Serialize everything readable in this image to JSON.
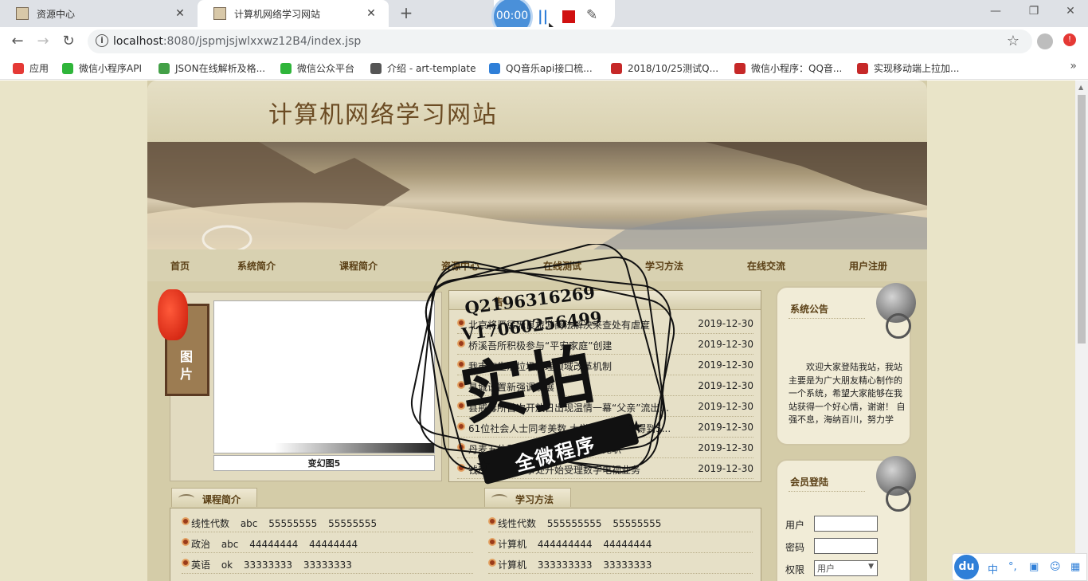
{
  "browser": {
    "tabs": [
      {
        "title": "资源中心",
        "active": false
      },
      {
        "title": "计算机网络学习网站",
        "active": true
      }
    ],
    "url_host": "localhost",
    "url_path": ":8080/jspmjsjwlxxwz12B4/index.jsp",
    "bookmarks": [
      {
        "label": "应用",
        "icon_color": "#e53935"
      },
      {
        "label": "微信小程序API",
        "icon_color": "#2fb53a"
      },
      {
        "label": "JSON在线解析及格...",
        "icon_color": "#43a047"
      },
      {
        "label": "微信公众平台",
        "icon_color": "#2fb53a"
      },
      {
        "label": "介绍 - art-template",
        "icon_color": "#555555"
      },
      {
        "label": "QQ音乐api接口梳...",
        "icon_color": "#2f7fd8"
      },
      {
        "label": "2018/10/25测试Q...",
        "icon_color": "#c62828"
      },
      {
        "label": "微信小程序：QQ音...",
        "icon_color": "#c62828"
      },
      {
        "label": "实现移动端上拉加...",
        "icon_color": "#c62828"
      }
    ],
    "more": "»"
  },
  "recorder": {
    "time": "00:00",
    "pause": "||"
  },
  "site": {
    "title": "计算机网络学习网站",
    "nav": [
      "首页",
      "系统简介",
      "课程简介",
      "资源中心",
      "在线测试",
      "学习方法",
      "在线交流",
      "用户注册"
    ],
    "image_tab": [
      "图",
      "片"
    ],
    "slide_caption": "变幻图5",
    "news_title": "告",
    "news": [
      {
        "title": "北京将严惩无良旅游商法解决来查处有虐度",
        "date": "2019-12-30"
      },
      {
        "title": "桥溪吾所积极参与“平安家庭”创建",
        "date": "2019-12-30"
      },
      {
        "title": "我市市生活垃圾处理领域改革机制",
        "date": "2019-12-30"
      },
      {
        "title": "县城设置新强调发展",
        "date": "2019-12-30"
      },
      {
        "title": "县戒毒所首次开放日出现温情一幕“父亲”流出...",
        "date": "2019-12-30"
      },
      {
        "title": "61位社会人士同考美数 大学数学教师只得到5...",
        "date": "2019-12-30"
      },
      {
        "title": "丹麦五位贸易促进大使被新政府免职",
        "date": "2019-12-30"
      },
      {
        "title": "钱库镇新安办事处开始受理数字电视业务",
        "date": "2019-12-30"
      }
    ],
    "notice": {
      "title": "系统公告",
      "text": "欢迎大家登陆我站，我站主要是为广大朋友精心制作的一个系统，希望大家能够在我站获得一个好心情，谢谢！ 自强不息，海纳百川，努力学"
    },
    "login": {
      "title": "会员登陆",
      "user_label": "用户",
      "pass_label": "密码",
      "role_label": "权限",
      "role_value": "用户"
    },
    "course_section": {
      "title": "课程简介",
      "rows": [
        "线性代数 abc 55555555 55555555",
        "政治 abc 44444444 44444444",
        "英语 ok 33333333 33333333"
      ]
    },
    "method_section": {
      "title": "学习方法",
      "rows": [
        "线性代数 555555555 55555555",
        "计算机 444444444 44444444",
        "计算机 333333333 33333333"
      ]
    }
  },
  "stamp": {
    "line1": "Q2196316269",
    "line2": "V17060256499",
    "big": "实拍",
    "ribbon": "全微程序"
  },
  "ime": {
    "logo": "du",
    "items": [
      "中",
      "°,",
      "▣",
      "☺",
      "▦"
    ]
  }
}
